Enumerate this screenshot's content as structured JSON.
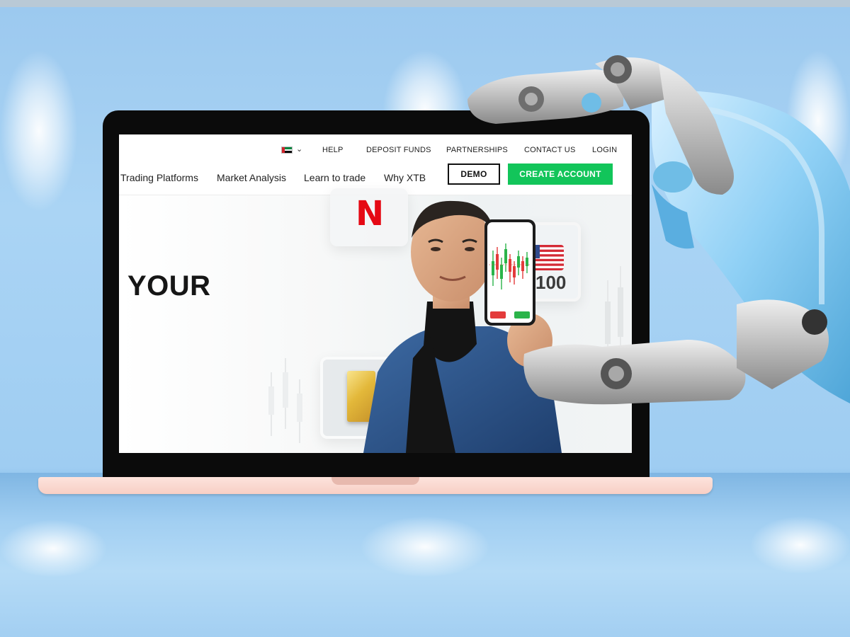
{
  "topbar": {
    "language_flag": "ae-flag-icon",
    "links": [
      "HELP",
      "DEPOSIT FUNDS",
      "PARTNERSHIPS",
      "CONTACT US",
      "LOGIN"
    ]
  },
  "nav": {
    "items": [
      "Trading Platforms",
      "Market Analysis",
      "Learn to trade",
      "Why XTB"
    ],
    "demo_label": "DEMO",
    "create_label": "CREATE ACCOUNT"
  },
  "hero": {
    "headline": "YOUR",
    "us_index_value": "100",
    "brand_letter": "N"
  },
  "colors": {
    "create_button": "#12c55a",
    "netflix_red": "#e50914",
    "background_sky": "#9fcdf2"
  }
}
